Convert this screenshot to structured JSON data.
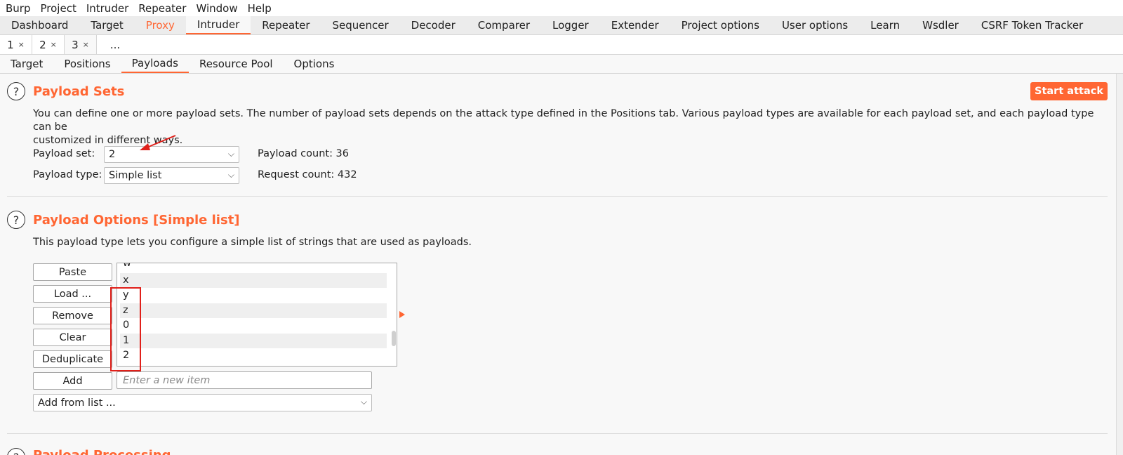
{
  "menubar": [
    "Burp",
    "Project",
    "Intruder",
    "Repeater",
    "Window",
    "Help"
  ],
  "main_tabs": [
    "Dashboard",
    "Target",
    "Proxy",
    "Intruder",
    "Repeater",
    "Sequencer",
    "Decoder",
    "Comparer",
    "Logger",
    "Extender",
    "Project options",
    "User options",
    "Learn",
    "Wsdler",
    "CSRF Token Tracker"
  ],
  "active_main_tab": "Intruder",
  "request_tabs": [
    {
      "label": "1",
      "close": "×"
    },
    {
      "label": "2",
      "close": "×"
    },
    {
      "label": "3",
      "close": "×"
    }
  ],
  "request_tabs_more": "...",
  "sub_tabs": [
    "Target",
    "Positions",
    "Payloads",
    "Resource Pool",
    "Options"
  ],
  "active_sub_tab": "Payloads",
  "payload_sets": {
    "title": "Payload Sets",
    "start_attack": "Start attack",
    "description_line1": "You can define one or more payload sets. The number of payload sets depends on the attack type defined in the Positions tab. Various payload types are available for each payload set, and each payload type can be",
    "description_line2": "customized in different ways.",
    "set_label": "Payload set:",
    "set_value": "2",
    "type_label": "Payload type:",
    "type_value": "Simple list",
    "payload_count": "Payload count: 36",
    "request_count": "Request count: 432"
  },
  "payload_options": {
    "title": "Payload Options [Simple list]",
    "description": "This payload type lets you configure a simple list of strings that are used as payloads.",
    "buttons": {
      "paste": "Paste",
      "load": "Load ...",
      "remove": "Remove",
      "clear": "Clear",
      "deduplicate": "Deduplicate",
      "add": "Add"
    },
    "list_items": [
      "w",
      "x",
      "y",
      "z",
      "0",
      "1",
      "2"
    ],
    "add_placeholder": "Enter a new item",
    "add_from_list": "Add from list ..."
  },
  "payload_processing": {
    "title": "Payload Processing"
  },
  "colors": {
    "accent": "#ff6633",
    "highlight_box": "#e0201a"
  },
  "icons": {
    "help": "?",
    "dropdown": "chevron-down",
    "close_tab": "×"
  }
}
